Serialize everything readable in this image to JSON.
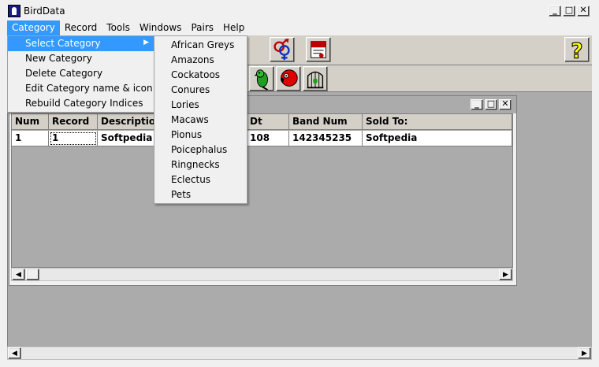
{
  "window": {
    "title": "BirdData"
  },
  "menubar": [
    "Category",
    "Record",
    "Tools",
    "Windows",
    "Pairs",
    "Help"
  ],
  "category_menu": [
    {
      "label": "Select Category",
      "submenu": true
    },
    {
      "label": "New Category"
    },
    {
      "label": "Delete Category"
    },
    {
      "label": "Edit Category name & icon"
    },
    {
      "label": "Rebuild Category Indices"
    }
  ],
  "select_category_submenu": [
    "African Greys",
    "Amazons",
    "Cockatoos",
    "Conures",
    "Lories",
    "Macaws",
    "Pionus",
    "Poicephalus",
    "Ringnecks",
    "Eclectus",
    "Pets"
  ],
  "toolbar1_icons": [
    "pairs-gender-icon",
    "certificate-icon",
    "help-icon"
  ],
  "toolbar2_icons": [
    "green-parrot-icon",
    "red-parrot-icon",
    "bird-cage-icon"
  ],
  "grid": {
    "columns": [
      "Num",
      "Record",
      "Description",
      "Dt",
      "Band Num",
      "Sold To:"
    ],
    "rows": [
      [
        "1",
        "1",
        "Softpedia",
        "108",
        "142345235",
        "Softpedia"
      ]
    ]
  },
  "colors": {
    "highlight": "#3399ff",
    "mdi_background": "#ababab",
    "face": "#d4d0c8"
  }
}
